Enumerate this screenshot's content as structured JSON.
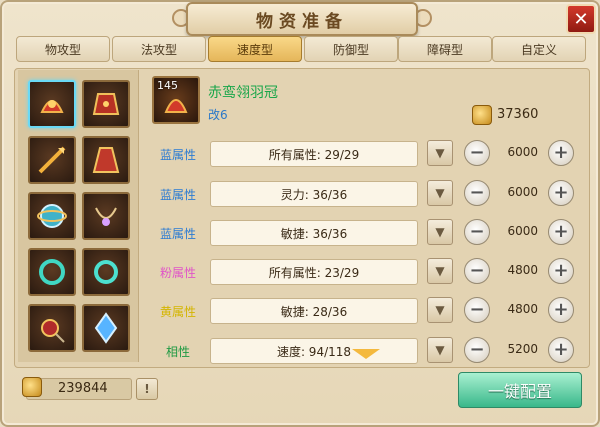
{
  "window": {
    "title": "物资准备",
    "close_label": "✕"
  },
  "tabs": [
    {
      "label": "物攻型",
      "active": false
    },
    {
      "label": "法攻型",
      "active": false
    },
    {
      "label": "速度型",
      "active": true
    },
    {
      "label": "防御型",
      "active": false
    },
    {
      "label": "障碍型",
      "active": false
    },
    {
      "label": "自定义",
      "active": false
    }
  ],
  "equipment_slots": [
    {
      "icon": "helmet-icon",
      "selected": true
    },
    {
      "icon": "armor-icon",
      "selected": false
    },
    {
      "icon": "weapon-icon",
      "selected": false
    },
    {
      "icon": "robe-icon",
      "selected": false
    },
    {
      "icon": "orb-icon",
      "selected": false
    },
    {
      "icon": "necklace-icon",
      "selected": false
    },
    {
      "icon": "bracelet-icon",
      "selected": false
    },
    {
      "icon": "ring-icon",
      "selected": false
    },
    {
      "icon": "amulet-icon",
      "selected": false
    },
    {
      "icon": "crystal-icon",
      "selected": false
    }
  ],
  "item": {
    "level": "145",
    "name": "赤鸾翎羽冠",
    "subtitle": "改6",
    "cost": "37360"
  },
  "attributes": [
    {
      "label": "蓝属性",
      "color": "#2b7bd3",
      "value": "所有属性: 29/29",
      "amount": "6000"
    },
    {
      "label": "蓝属性",
      "color": "#2b7bd3",
      "value": "灵力: 36/36",
      "amount": "6000"
    },
    {
      "label": "蓝属性",
      "color": "#2b7bd3",
      "value": "敏捷: 36/36",
      "amount": "6000"
    },
    {
      "label": "粉属性",
      "color": "#e055c8",
      "value": "所有属性: 23/29",
      "amount": "4800"
    },
    {
      "label": "黄属性",
      "color": "#d4b500",
      "value": "敏捷: 28/36",
      "amount": "4800"
    },
    {
      "label": "相性",
      "color": "#1f9a43",
      "value": "速度: 94/118",
      "amount": "5200"
    }
  ],
  "footer": {
    "gold": "239844",
    "warn_label": "!",
    "config_label": "一键配置"
  }
}
